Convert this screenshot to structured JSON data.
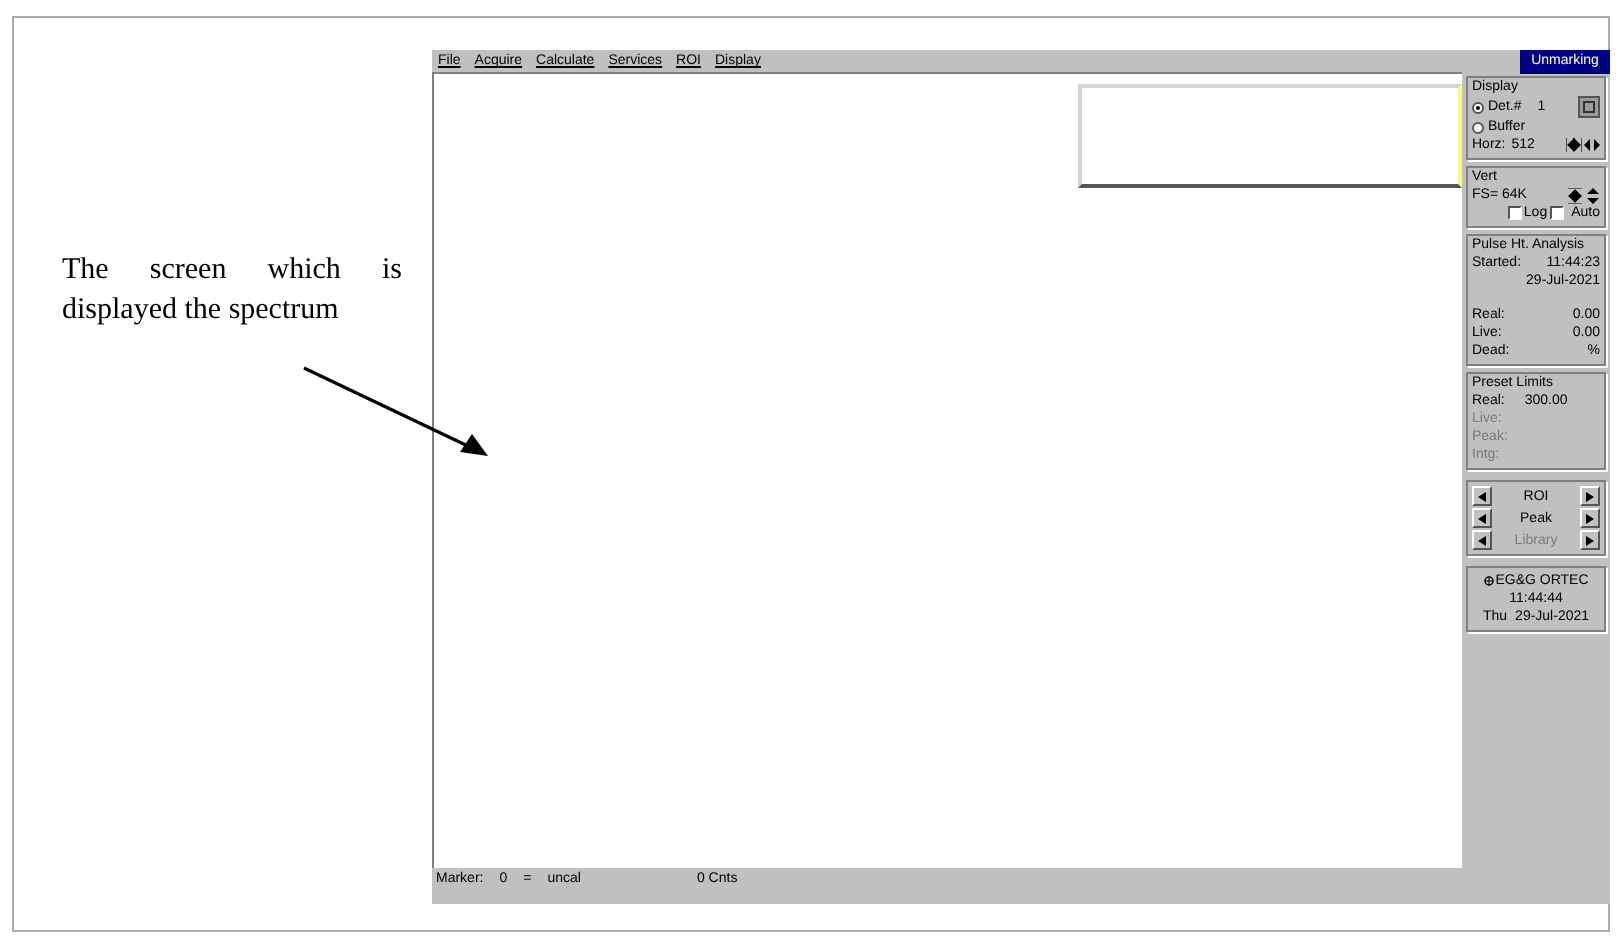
{
  "annotation": {
    "text": "The screen which is displayed the spectrum"
  },
  "window": {
    "menu": [
      {
        "label": "File"
      },
      {
        "label": "Acquire"
      },
      {
        "label": "Calculate"
      },
      {
        "label": "Services"
      },
      {
        "label": "ROI"
      },
      {
        "label": "Display"
      }
    ],
    "mode_button": "Unmarking"
  },
  "display": {
    "title": "Display",
    "sources": [
      {
        "label": "Det.#",
        "selected": true
      },
      {
        "label": "Buffer",
        "selected": false
      }
    ],
    "detector": "1",
    "horz_label": "Horz:",
    "horz": "512"
  },
  "vert": {
    "title": "Vert",
    "fs": "FS= 64K",
    "options": [
      {
        "label": "Log",
        "checked": false
      },
      {
        "label": "Auto",
        "checked": false
      }
    ]
  },
  "analysis": {
    "title": "Pulse Ht. Analysis",
    "started_label": "Started:",
    "started_time": "11:44:23",
    "started_date": "29-Jul-2021",
    "rows": [
      {
        "label": "Real:",
        "value": "0.00"
      },
      {
        "label": "Live:",
        "value": "0.00"
      },
      {
        "label": "Dead:",
        "value": "%"
      }
    ]
  },
  "preset_limits": {
    "title": "Preset Limits",
    "rows": [
      {
        "label": "Real:",
        "value": "300.00",
        "disabled": false
      },
      {
        "label": "Live:",
        "value": "",
        "disabled": true
      },
      {
        "label": "Peak:",
        "value": "",
        "disabled": true
      },
      {
        "label": "Intg:",
        "value": "",
        "disabled": true
      }
    ]
  },
  "navigation": [
    {
      "label": "ROI",
      "disabled": false
    },
    {
      "label": "Peak",
      "disabled": false
    },
    {
      "label": "Library",
      "disabled": true
    }
  ],
  "info": {
    "company": "EG&G ORTEC",
    "time": "11:44:44",
    "day": "Thu",
    "date": "29-Jul-2021"
  },
  "status_bar": {
    "marker_label": "Marker:",
    "marker": "0",
    "equals": "=",
    "calibration": "uncal",
    "counts": "0 Cnts"
  }
}
